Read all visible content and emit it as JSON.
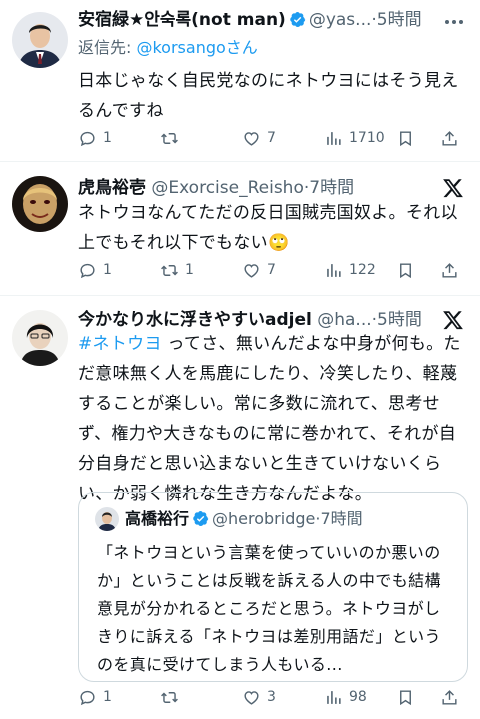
{
  "tweets": [
    {
      "name": "安宿緑★안숙록(not man)",
      "handle": "@yas...",
      "time": "5時間",
      "reply_prefix": "返信先: ",
      "reply_handle": "@korsangoさん",
      "text": "日本じゃなく自民党なのにネトウヨにはそう見えるんですね",
      "replies": "1",
      "retweets": "",
      "likes": "7",
      "views": "1710"
    },
    {
      "name": "虎鳥裕壱",
      "handle": "@Exorcise_Reisho",
      "time": "7時間",
      "text": "ネトウヨなんてただの反日国賊売国奴よ。それ以上でもそれ以下でもない🙄",
      "replies": "1",
      "retweets": "1",
      "likes": "7",
      "views": "122"
    },
    {
      "name": "今かなり水に浮きやすいadjel",
      "handle": "@ha...",
      "time": "5時間",
      "hashtag": "#ネトウヨ",
      "text": "ってさ、無いんだよな中身が何も。ただ意味無く人を馬鹿にしたり、冷笑したり、軽蔑することが楽しい。常に多数に流れて、思考せず、権力や大きなものに常に巻かれて、それが自分自身だと思い込まないと生きていけないくらい、か弱く憐れな生き方なんだよな。",
      "quote": {
        "name": "高橋裕行",
        "handle": "@herobridge",
        "time": "7時間",
        "text": "「ネトウヨという言葉を使っていいのか悪いのか」ということは反戦を訴える人の中でも結構意見が分かれるところだと思う。ネトウヨがしきりに訴える「ネトウヨは差別用語だ」というのを真に受けてしまう人もいる..."
      },
      "replies": "1",
      "retweets": "",
      "likes": "3",
      "views": "98"
    }
  ],
  "separator": "·",
  "colors": {
    "accent": "#1d9bf0",
    "secondary": "#536471",
    "text": "#0f1419",
    "border": "#eff3f4"
  }
}
